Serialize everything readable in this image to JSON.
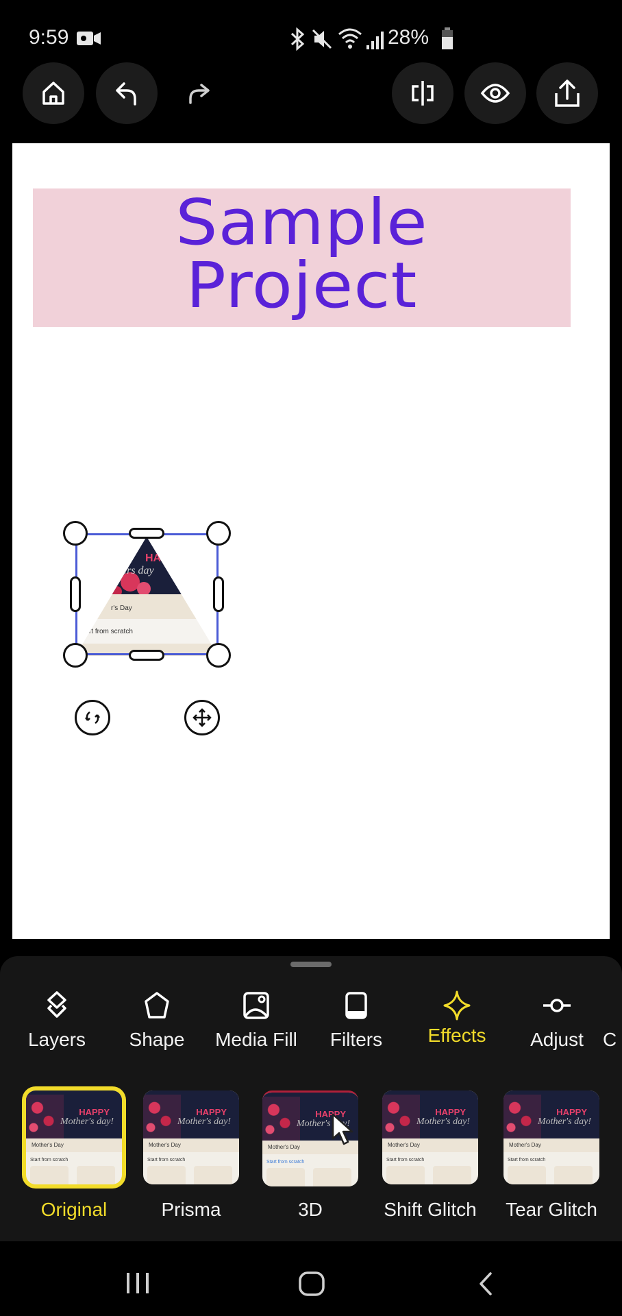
{
  "status_bar": {
    "time": "9:59",
    "battery": "28%",
    "icons": [
      "video-record-icon",
      "bluetooth-icon",
      "mute-icon",
      "wifi-icon",
      "signal-icon",
      "battery-icon"
    ]
  },
  "toolbar": {
    "left": [
      {
        "name": "home",
        "icon": "home-icon"
      },
      {
        "name": "undo",
        "icon": "undo-icon"
      },
      {
        "name": "redo",
        "icon": "redo-icon"
      }
    ],
    "right": [
      {
        "name": "split",
        "icon": "split-icon"
      },
      {
        "name": "preview",
        "icon": "eye-icon"
      },
      {
        "name": "share",
        "icon": "share-icon"
      }
    ]
  },
  "canvas": {
    "title_line1": "Sample",
    "title_line2": "Project",
    "banner_color": "#f1d1d9",
    "title_color": "#5a22d8",
    "selected_element": {
      "type": "triangle-media",
      "text_fragments": [
        "HAPPY",
        "ers day",
        "r's Day",
        "rt from scratch"
      ]
    },
    "selection_color": "#4a5bd6"
  },
  "bottom_panel": {
    "tools": [
      {
        "label": "Layers",
        "icon": "layers-icon",
        "active": false
      },
      {
        "label": "Shape",
        "icon": "pentagon-icon",
        "active": false
      },
      {
        "label": "Media Fill",
        "icon": "media-fill-icon",
        "active": false
      },
      {
        "label": "Filters",
        "icon": "filters-icon",
        "active": false
      },
      {
        "label": "Effects",
        "icon": "sparkle-icon",
        "active": true
      },
      {
        "label": "Adjust",
        "icon": "adjust-icon",
        "active": false
      },
      {
        "label": "C",
        "icon": "",
        "active": false
      }
    ],
    "effects": [
      {
        "label": "Original",
        "active": true
      },
      {
        "label": "Prisma",
        "active": false
      },
      {
        "label": "3D",
        "active": false
      },
      {
        "label": "Shift Glitch",
        "active": false
      },
      {
        "label": "Tear Glitch",
        "active": false
      }
    ],
    "thumb_text": {
      "happy": "HAPPY",
      "mothers": "Mother's day!",
      "band": "Mother's Day",
      "scratch": "Start from scratch"
    },
    "accent_color": "#f2dc2a"
  },
  "nav_bar": {
    "items": [
      "recents-icon",
      "home-icon",
      "back-icon"
    ]
  }
}
